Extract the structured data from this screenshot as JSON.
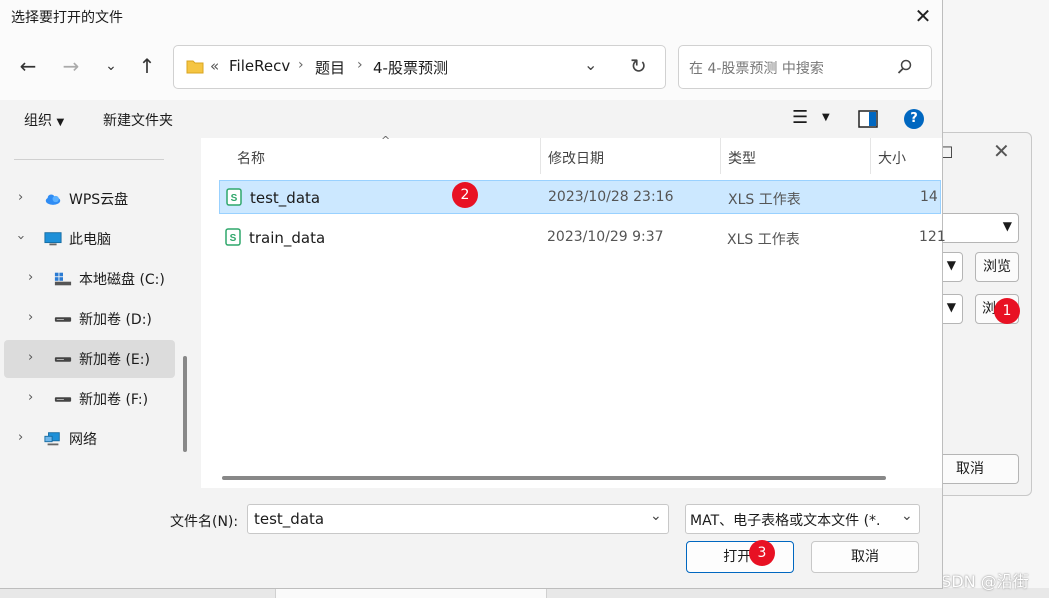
{
  "background_window": {
    "browse_1": "浏览",
    "browse_2": "浏",
    "cancel": "取消"
  },
  "watermark": "CSDN @沿街",
  "dialog": {
    "title": "选择要打开的文件",
    "breadcrumb": {
      "prefix": "«",
      "items": [
        "FileRecv",
        "题目",
        "4-股票预测"
      ]
    },
    "search_placeholder": "在 4-股票预测 中搜索",
    "toolbar": {
      "organize": "组织",
      "new_folder": "新建文件夹"
    },
    "nav_items": [
      {
        "label": "WPS云盘",
        "icon": "cloud-icon",
        "expanded": false
      },
      {
        "label": "此电脑",
        "icon": "computer-icon",
        "expanded": true
      },
      {
        "label": "本地磁盘 (C:)",
        "icon": "windows-drive-icon",
        "expanded": false
      },
      {
        "label": "新加卷 (D:)",
        "icon": "drive-icon",
        "expanded": false
      },
      {
        "label": "新加卷 (E:)",
        "icon": "drive-icon",
        "expanded": false,
        "selected": true
      },
      {
        "label": "新加卷 (F:)",
        "icon": "drive-icon",
        "expanded": false
      },
      {
        "label": "网络",
        "icon": "network-icon",
        "expanded": false
      }
    ],
    "columns": {
      "name": "名称",
      "modified": "修改日期",
      "type": "类型",
      "size": "大小"
    },
    "files": [
      {
        "name": "test_data",
        "modified": "2023/10/28 23:16",
        "type": "XLS 工作表",
        "size": "14",
        "selected": true
      },
      {
        "name": "train_data",
        "modified": "2023/10/29 9:37",
        "type": "XLS 工作表",
        "size": "121",
        "selected": false
      }
    ],
    "filename_label": "文件名(N):",
    "filename_value": "test_data",
    "filetype_value": "MAT、电子表格或文本文件 (*.",
    "open_button": "打开(",
    "cancel_button": "取消"
  },
  "annotations": {
    "step1": "1",
    "step2": "2",
    "step3": "3"
  },
  "colors": {
    "accent": "#0067c0",
    "selection": "#cce8ff",
    "badge": "#e81123"
  }
}
